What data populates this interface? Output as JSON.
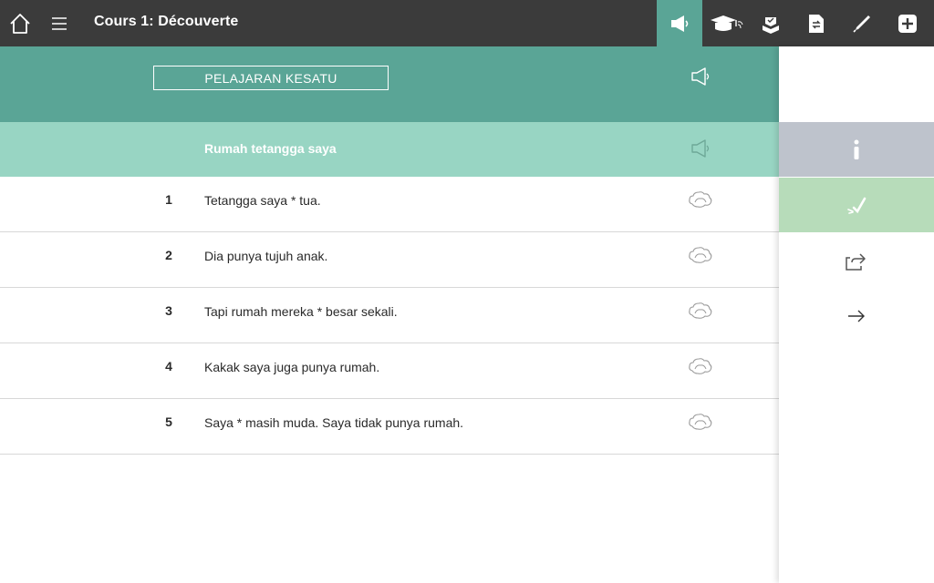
{
  "app": {
    "title": "Cours 1: Découverte"
  },
  "toolbar": {
    "icons": [
      "home-icon",
      "hamburger-menu-icon",
      "megaphone-icon",
      "graduation-cap-icon",
      "book-icon",
      "document-swap-icon",
      "pen-icon",
      "plus-icon"
    ],
    "active_tool": "megaphone-icon",
    "accent_color": "#5aa596"
  },
  "lesson": {
    "title": "PELAJARAN KESATU",
    "subtitle": "Rumah tetangga saya",
    "header_color": "#5aa596",
    "subheader_color": "#98d5c3"
  },
  "sentences": [
    {
      "num": "1",
      "text": "Tetangga saya * tua."
    },
    {
      "num": "2",
      "text": "Dia punya tujuh anak."
    },
    {
      "num": "3",
      "text": "Tapi rumah mereka * besar sekali."
    },
    {
      "num": "4",
      "text": "Kakak saya juga punya rumah."
    },
    {
      "num": "5",
      "text": "Saya * masih muda. Saya tidak punya rumah."
    }
  ],
  "side_panel": {
    "icons": [
      "info-icon",
      "brush-check-icon",
      "share-icon",
      "arrow-right-icon"
    ],
    "info_color": "#bec3cc",
    "check_color": "#b7dcba"
  }
}
